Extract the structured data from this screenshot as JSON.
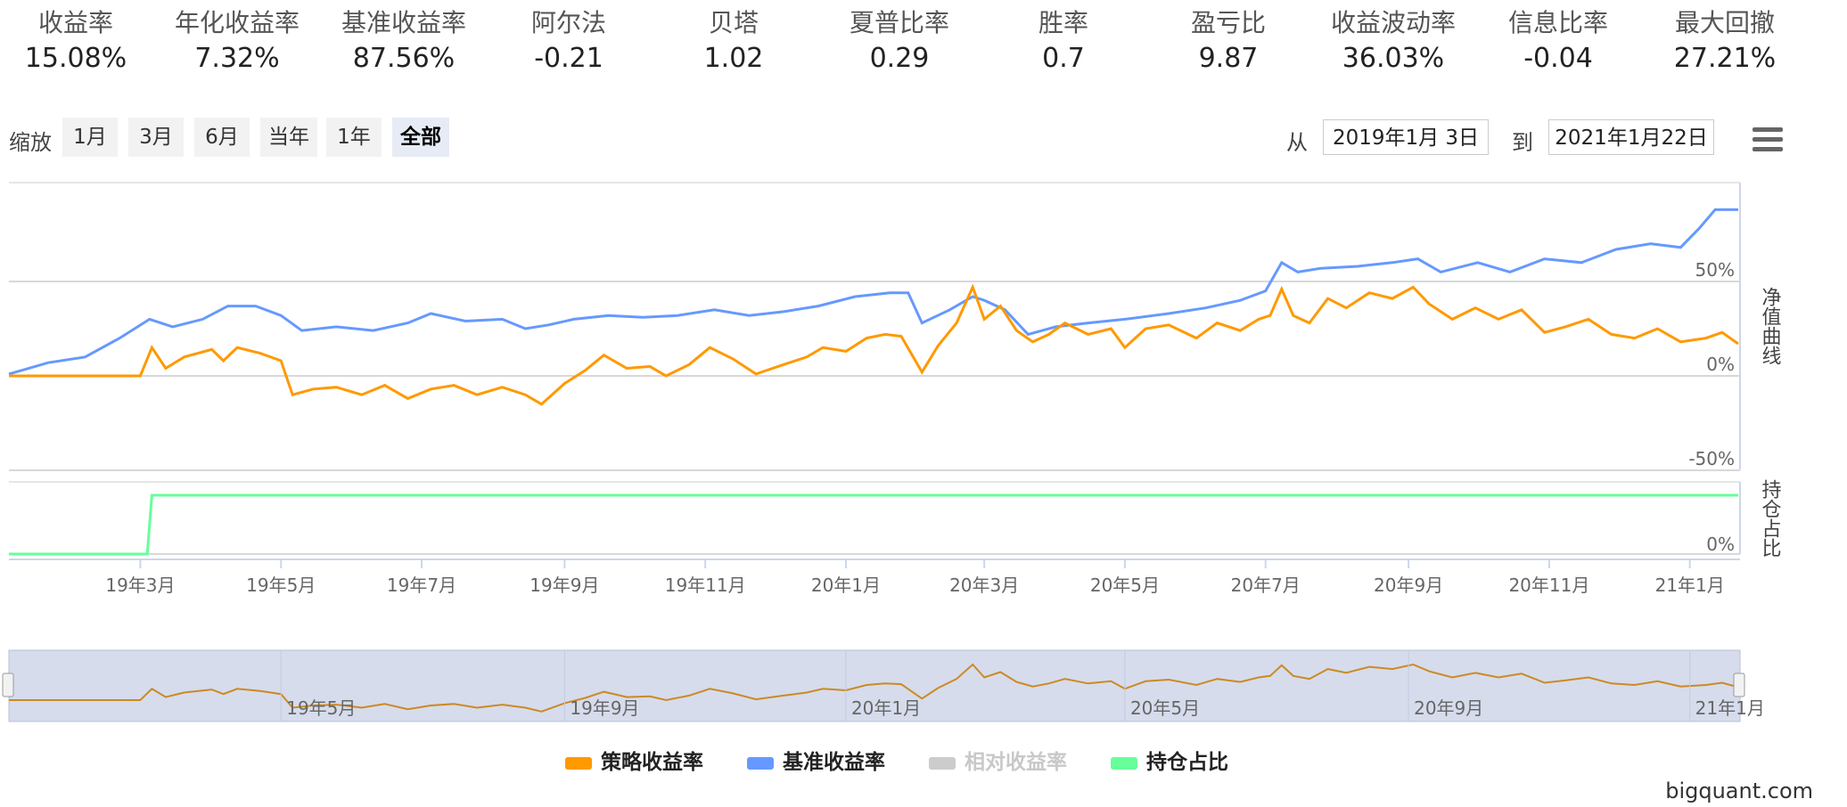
{
  "metrics": [
    {
      "label": "收益率",
      "value": "15.08%"
    },
    {
      "label": "年化收益率",
      "value": "7.32%"
    },
    {
      "label": "基准收益率",
      "value": "87.56%"
    },
    {
      "label": "阿尔法",
      "value": "-0.21"
    },
    {
      "label": "贝塔",
      "value": "1.02"
    },
    {
      "label": "夏普比率",
      "value": "0.29"
    },
    {
      "label": "胜率",
      "value": "0.7"
    },
    {
      "label": "盈亏比",
      "value": "9.87"
    },
    {
      "label": "收益波动率",
      "value": "36.03%"
    },
    {
      "label": "信息比率",
      "value": "-0.04"
    },
    {
      "label": "最大回撤",
      "value": "27.21%"
    }
  ],
  "range_selector": {
    "zoom_label": "缩放",
    "buttons": [
      "1月",
      "3月",
      "6月",
      "当年",
      "1年",
      "全部"
    ],
    "active": "全部",
    "from_label": "从",
    "from_value": "2019年1月 3日",
    "to_label": "到",
    "to_value": "2021年1月22日"
  },
  "menu": {
    "icon": "hamburger-menu-icon"
  },
  "chart_data": {
    "type": "line",
    "x_range": [
      "2019-01-03",
      "2021-01-22"
    ],
    "x_tick_labels": [
      "19年3月",
      "19年5月",
      "19年7月",
      "19年9月",
      "19年11月",
      "20年1月",
      "20年3月",
      "20年5月",
      "20年7月",
      "20年9月",
      "20年11月",
      "21年1月"
    ],
    "panels": [
      {
        "name": "净值曲线",
        "y_ticks": [
          "50%",
          "0%",
          "-50%"
        ],
        "ylim": [
          -50,
          100
        ],
        "series": [
          {
            "name": "策略收益率",
            "color": "#ff9900",
            "points": [
              [
                "2019-01-03",
                0
              ],
              [
                "2019-03-01",
                0
              ],
              [
                "2019-03-06",
                15
              ],
              [
                "2019-03-12",
                4
              ],
              [
                "2019-03-20",
                10
              ],
              [
                "2019-04-01",
                14
              ],
              [
                "2019-04-06",
                8
              ],
              [
                "2019-04-12",
                15
              ],
              [
                "2019-04-22",
                12
              ],
              [
                "2019-05-01",
                8
              ],
              [
                "2019-05-06",
                -10
              ],
              [
                "2019-05-15",
                -7
              ],
              [
                "2019-05-25",
                -6
              ],
              [
                "2019-06-05",
                -10
              ],
              [
                "2019-06-15",
                -5
              ],
              [
                "2019-06-25",
                -12
              ],
              [
                "2019-07-05",
                -7
              ],
              [
                "2019-07-15",
                -5
              ],
              [
                "2019-07-25",
                -10
              ],
              [
                "2019-08-05",
                -6
              ],
              [
                "2019-08-15",
                -10
              ],
              [
                "2019-08-22",
                -15
              ],
              [
                "2019-09-01",
                -4
              ],
              [
                "2019-09-10",
                3
              ],
              [
                "2019-09-18",
                11
              ],
              [
                "2019-09-28",
                4
              ],
              [
                "2019-10-08",
                5
              ],
              [
                "2019-10-15",
                0
              ],
              [
                "2019-10-25",
                6
              ],
              [
                "2019-11-03",
                15
              ],
              [
                "2019-11-13",
                9
              ],
              [
                "2019-11-23",
                1
              ],
              [
                "2019-12-05",
                6
              ],
              [
                "2019-12-15",
                10
              ],
              [
                "2019-12-22",
                15
              ],
              [
                "2020-01-01",
                13
              ],
              [
                "2020-01-10",
                20
              ],
              [
                "2020-01-18",
                22
              ],
              [
                "2020-01-25",
                21
              ],
              [
                "2020-02-03",
                2
              ],
              [
                "2020-02-10",
                16
              ],
              [
                "2020-02-18",
                28
              ],
              [
                "2020-02-25",
                47
              ],
              [
                "2020-03-01",
                30
              ],
              [
                "2020-03-08",
                37
              ],
              [
                "2020-03-15",
                24
              ],
              [
                "2020-03-22",
                18
              ],
              [
                "2020-03-29",
                22
              ],
              [
                "2020-04-05",
                28
              ],
              [
                "2020-04-15",
                22
              ],
              [
                "2020-04-25",
                25
              ],
              [
                "2020-05-01",
                15
              ],
              [
                "2020-05-10",
                25
              ],
              [
                "2020-05-20",
                27
              ],
              [
                "2020-06-01",
                20
              ],
              [
                "2020-06-10",
                28
              ],
              [
                "2020-06-20",
                24
              ],
              [
                "2020-06-28",
                30
              ],
              [
                "2020-07-03",
                32
              ],
              [
                "2020-07-08",
                46
              ],
              [
                "2020-07-13",
                32
              ],
              [
                "2020-07-20",
                28
              ],
              [
                "2020-07-28",
                41
              ],
              [
                "2020-08-05",
                36
              ],
              [
                "2020-08-15",
                44
              ],
              [
                "2020-08-25",
                41
              ],
              [
                "2020-09-03",
                47
              ],
              [
                "2020-09-10",
                38
              ],
              [
                "2020-09-20",
                30
              ],
              [
                "2020-09-30",
                36
              ],
              [
                "2020-10-10",
                30
              ],
              [
                "2020-10-20",
                35
              ],
              [
                "2020-10-30",
                23
              ],
              [
                "2020-11-08",
                26
              ],
              [
                "2020-11-18",
                30
              ],
              [
                "2020-11-28",
                22
              ],
              [
                "2020-12-08",
                20
              ],
              [
                "2020-12-18",
                25
              ],
              [
                "2020-12-28",
                18
              ],
              [
                "2021-01-08",
                20
              ],
              [
                "2021-01-15",
                23
              ],
              [
                "2021-01-22",
                17
              ]
            ]
          },
          {
            "name": "基准收益率",
            "color": "#6699ff",
            "points": [
              [
                "2019-01-03",
                1
              ],
              [
                "2019-01-20",
                7
              ],
              [
                "2019-02-05",
                10
              ],
              [
                "2019-02-20",
                20
              ],
              [
                "2019-03-05",
                30
              ],
              [
                "2019-03-15",
                26
              ],
              [
                "2019-03-28",
                30
              ],
              [
                "2019-04-08",
                37
              ],
              [
                "2019-04-20",
                37
              ],
              [
                "2019-05-01",
                32
              ],
              [
                "2019-05-10",
                24
              ],
              [
                "2019-05-25",
                26
              ],
              [
                "2019-06-10",
                24
              ],
              [
                "2019-06-25",
                28
              ],
              [
                "2019-07-05",
                33
              ],
              [
                "2019-07-20",
                29
              ],
              [
                "2019-08-05",
                30
              ],
              [
                "2019-08-15",
                25
              ],
              [
                "2019-08-25",
                27
              ],
              [
                "2019-09-05",
                30
              ],
              [
                "2019-09-20",
                32
              ],
              [
                "2019-10-05",
                31
              ],
              [
                "2019-10-20",
                32
              ],
              [
                "2019-11-05",
                35
              ],
              [
                "2019-11-20",
                32
              ],
              [
                "2019-12-05",
                34
              ],
              [
                "2019-12-20",
                37
              ],
              [
                "2020-01-05",
                42
              ],
              [
                "2020-01-20",
                44
              ],
              [
                "2020-01-28",
                44
              ],
              [
                "2020-02-03",
                28
              ],
              [
                "2020-02-15",
                35
              ],
              [
                "2020-02-25",
                42
              ],
              [
                "2020-03-01",
                40
              ],
              [
                "2020-03-10",
                35
              ],
              [
                "2020-03-20",
                22
              ],
              [
                "2020-04-01",
                26
              ],
              [
                "2020-04-15",
                28
              ],
              [
                "2020-05-01",
                30
              ],
              [
                "2020-05-20",
                33
              ],
              [
                "2020-06-05",
                36
              ],
              [
                "2020-06-20",
                40
              ],
              [
                "2020-07-01",
                45
              ],
              [
                "2020-07-08",
                60
              ],
              [
                "2020-07-15",
                55
              ],
              [
                "2020-07-25",
                57
              ],
              [
                "2020-08-10",
                58
              ],
              [
                "2020-08-25",
                60
              ],
              [
                "2020-09-05",
                62
              ],
              [
                "2020-09-15",
                55
              ],
              [
                "2020-10-01",
                60
              ],
              [
                "2020-10-15",
                55
              ],
              [
                "2020-10-30",
                62
              ],
              [
                "2020-11-15",
                60
              ],
              [
                "2020-11-30",
                67
              ],
              [
                "2020-12-15",
                70
              ],
              [
                "2020-12-28",
                68
              ],
              [
                "2021-01-05",
                78
              ],
              [
                "2021-01-12",
                88
              ],
              [
                "2021-01-22",
                88
              ]
            ]
          }
        ]
      },
      {
        "name": "持仓占比",
        "y_ticks": [
          "0%"
        ],
        "ylim": [
          0,
          1.2
        ],
        "series": [
          {
            "name": "持仓占比",
            "color": "#66ff99",
            "points": [
              [
                "2019-01-03",
                0
              ],
              [
                "2019-03-04",
                0
              ],
              [
                "2019-03-06",
                1
              ],
              [
                "2021-01-22",
                1
              ]
            ]
          }
        ]
      }
    ],
    "navigator": {
      "x_tick_labels": [
        "19年5月",
        "19年9月",
        "20年1月",
        "20年5月",
        "20年9月",
        "21年1月"
      ],
      "series": "策略收益率"
    },
    "legend": [
      {
        "name": "策略收益率",
        "color": "#ff9900",
        "visible": true
      },
      {
        "name": "基准收益率",
        "color": "#6699ff",
        "visible": true
      },
      {
        "name": "相对收益率",
        "color": "#cccccc",
        "visible": false
      },
      {
        "name": "持仓占比",
        "color": "#66ff99",
        "visible": true
      }
    ],
    "legend_position": "bottom",
    "grid": true
  },
  "credit": "bigquant.com"
}
